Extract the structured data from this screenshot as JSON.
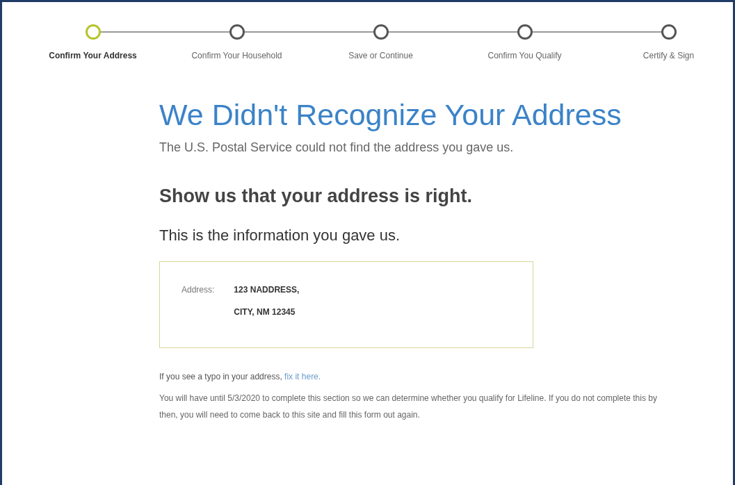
{
  "steps": [
    {
      "label": "Confirm Your Address",
      "selected": true
    },
    {
      "label": "Confirm Your Household",
      "selected": false
    },
    {
      "label": "Save or Continue",
      "selected": false
    },
    {
      "label": "Confirm You Qualify",
      "selected": false
    },
    {
      "label": "Certify & Sign",
      "selected": false
    }
  ],
  "title": "We Didn't Recognize Your Address",
  "subtitle": "The U.S. Postal Service could not find the address you gave us.",
  "heading": "Show us that your address is right.",
  "subheading": "This is the information you gave us.",
  "address": {
    "label": "Address:",
    "lines": [
      "123 NADDRESS,",
      "CITY, NM 12345"
    ]
  },
  "typo_note": {
    "text": "If you see a typo in your address,",
    "link": "fix it here."
  },
  "deadline_note": "You will have until 5/3/2020 to complete this section so we can determine whether you qualify for Lifeline. If you do not complete this by then, you will need to come back to this site and fill this form out again."
}
